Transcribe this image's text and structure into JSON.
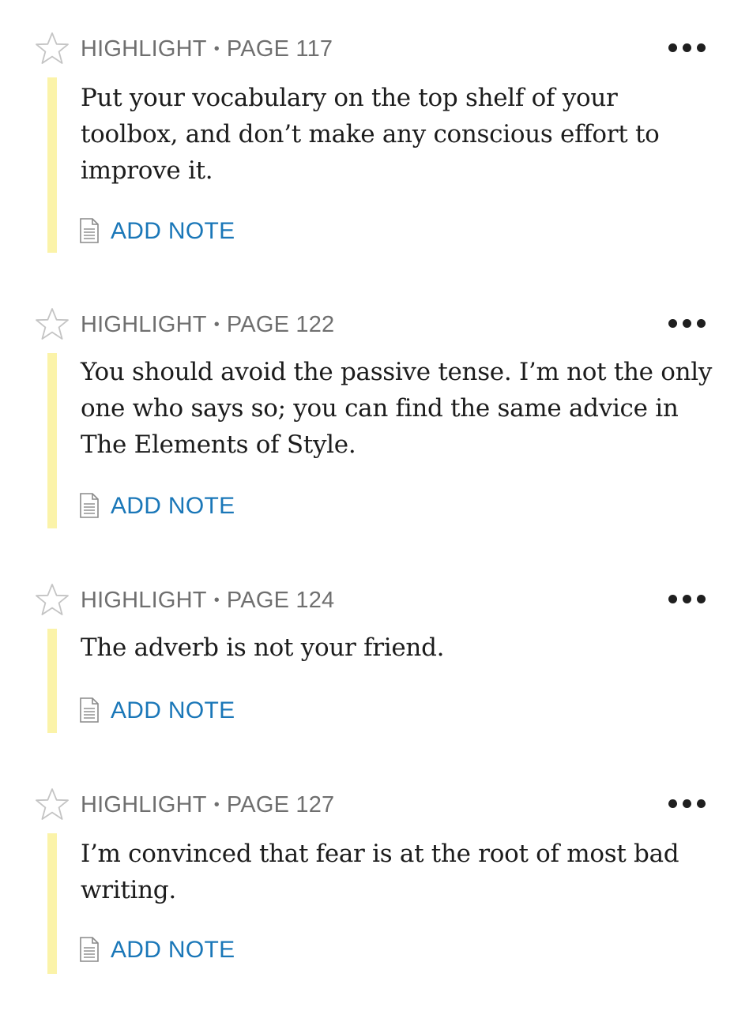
{
  "highlights": [
    {
      "type": "HIGHLIGHT",
      "page": "PAGE 117",
      "text": "Put your vocabulary on the top shelf of your toolbox, and don’t make any conscious effort to improve it.",
      "add_note_label": "ADD NOTE",
      "starred": false
    },
    {
      "type": "HIGHLIGHT",
      "page": "PAGE 122",
      "text": "You should avoid the passive tense. I’m not the only one who says so; you can find the same advice in The Elements of Style.",
      "add_note_label": "ADD NOTE",
      "starred": false
    },
    {
      "type": "HIGHLIGHT",
      "page": "PAGE 124",
      "text": "The adverb is not your friend.",
      "add_note_label": "ADD NOTE",
      "starred": false
    },
    {
      "type": "HIGHLIGHT",
      "page": "PAGE 127",
      "text": "I’m convinced that fear is at the root of most bad writing.",
      "add_note_label": "ADD NOTE",
      "starred": false
    }
  ],
  "separator": "•",
  "icons": {
    "star": "star-outline-icon",
    "menu": "more-horizontal-icon",
    "note": "note-document-icon"
  },
  "colors": {
    "highlight": "#fbf3a9",
    "link": "#1a77b8",
    "meta": "#6f6f6f",
    "text": "#1c1c1c"
  }
}
